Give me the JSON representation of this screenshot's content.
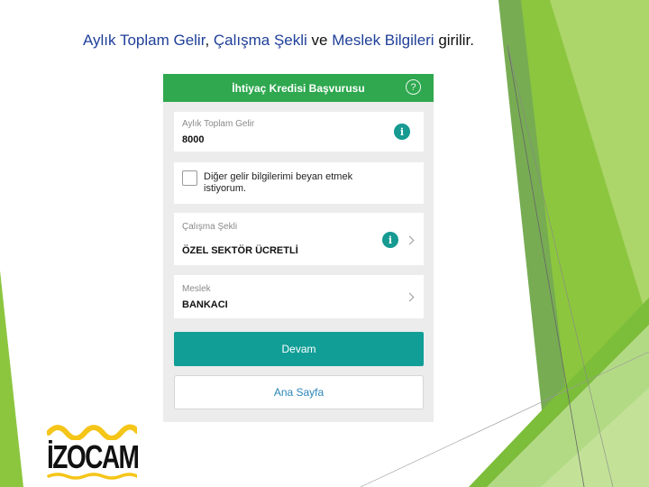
{
  "slide": {
    "headline_part1": "Aylık Toplam Gelir",
    "headline_sep1": ", ",
    "headline_part2": "Çalışma Şekli",
    "headline_sep2": " ve ",
    "headline_part3": "Meslek Bilgileri",
    "headline_tail": " girilir."
  },
  "app": {
    "title": "İhtiyaç Kredisi Başvurusu",
    "help_icon": "question-circle-icon",
    "income": {
      "label": "Aylık Toplam Gelir",
      "value": "8000",
      "icon": "info-icon"
    },
    "other_income_checkbox": {
      "label": "Diğer gelir bilgilerimi beyan etmek istiyorum.",
      "checked": false
    },
    "work_type": {
      "label": "Çalışma Şekli",
      "value": "ÖZEL SEKTÖR ÜCRETLİ",
      "icon": "info-icon"
    },
    "profession": {
      "label": "Meslek",
      "value": "BANKACI"
    },
    "continue_button": "Devam",
    "home_button": "Ana Sayfa"
  },
  "logo": {
    "text": "İZOCAM",
    "mark": "®"
  },
  "colors": {
    "header_green": "#2fa84f",
    "primary_button": "#119e97",
    "info_icon": "#169a92",
    "link_blue": "#2a86b8",
    "logo_yellow": "#f5c518",
    "accent_green": "#8cc63f"
  },
  "icons": {
    "info": "i",
    "help": "?"
  }
}
